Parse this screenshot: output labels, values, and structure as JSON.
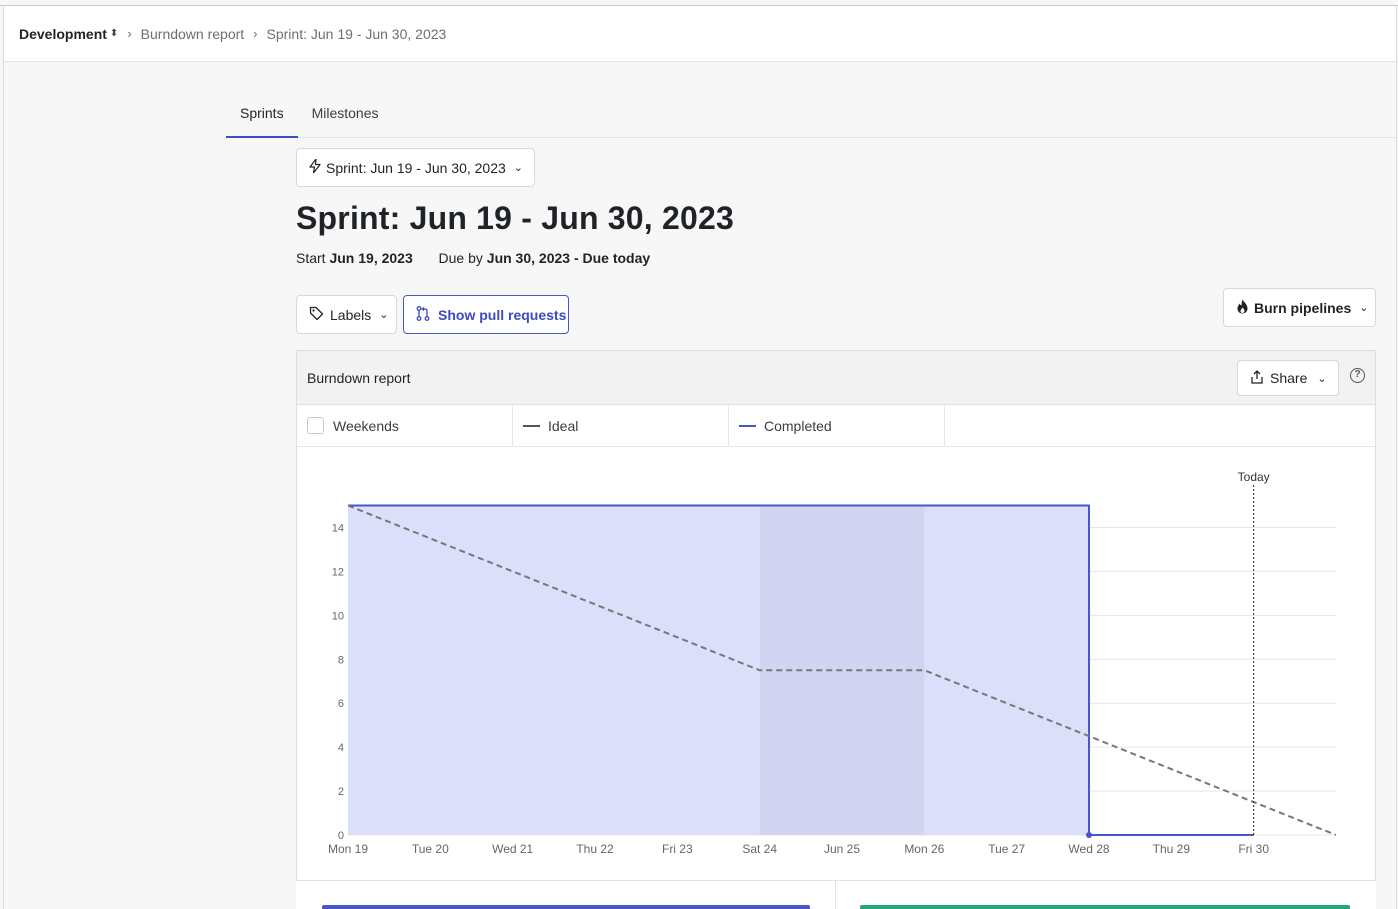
{
  "breadcrumb": {
    "workspace": "Development",
    "report": "Burndown report",
    "sprint": "Sprint: Jun 19 - Jun 30, 2023"
  },
  "tabs": [
    {
      "label": "Sprints",
      "active": true
    },
    {
      "label": "Milestones",
      "active": false
    }
  ],
  "sprint_select": {
    "label": "Sprint: Jun 19 - Jun 30, 2023",
    "icon": "lightning-icon"
  },
  "title": "Sprint: Jun 19 - Jun 30, 2023",
  "dates": {
    "start_label": "Start",
    "start_value": "Jun 19, 2023",
    "due_label": "Due by",
    "due_value": "Jun 30, 2023 - Due today"
  },
  "toolbar": {
    "labels_button": "Labels",
    "pull_requests_button": "Show pull requests",
    "burn_button": "Burn pipelines"
  },
  "report": {
    "title": "Burndown report",
    "share_label": "Share",
    "help_glyph": "?"
  },
  "legend": {
    "weekends": "Weekends",
    "ideal": "Ideal",
    "completed": "Completed"
  },
  "colors": {
    "accent": "#4756c9",
    "completed_fill": "#dcdffa",
    "weekend_fill": "#d0d3f0",
    "ideal": "#777777",
    "green": "#1fa87a"
  },
  "chart_data": {
    "type": "area",
    "categories": [
      "Mon 19",
      "Tue 20",
      "Wed 21",
      "Thu 22",
      "Fri 23",
      "Sat 24",
      "Jun 25",
      "Mon 26",
      "Tue 27",
      "Wed 28",
      "Thu 29",
      "Fri 30"
    ],
    "ylim": [
      0,
      15
    ],
    "yticks": [
      0,
      2,
      4,
      6,
      8,
      10,
      12,
      14
    ],
    "weekend": {
      "from": "Sat 24",
      "to": "Mon 26"
    },
    "today": {
      "label": "Today",
      "at": "Fri 30"
    },
    "series": [
      {
        "name": "Ideal",
        "style": "dashed",
        "x": [
          0,
          5,
          7,
          12
        ],
        "values": [
          15,
          7.5,
          7.5,
          0
        ]
      },
      {
        "name": "Completed",
        "style": "area",
        "x": [
          0,
          9,
          9,
          11
        ],
        "values": [
          15,
          15,
          0,
          0
        ]
      }
    ]
  }
}
